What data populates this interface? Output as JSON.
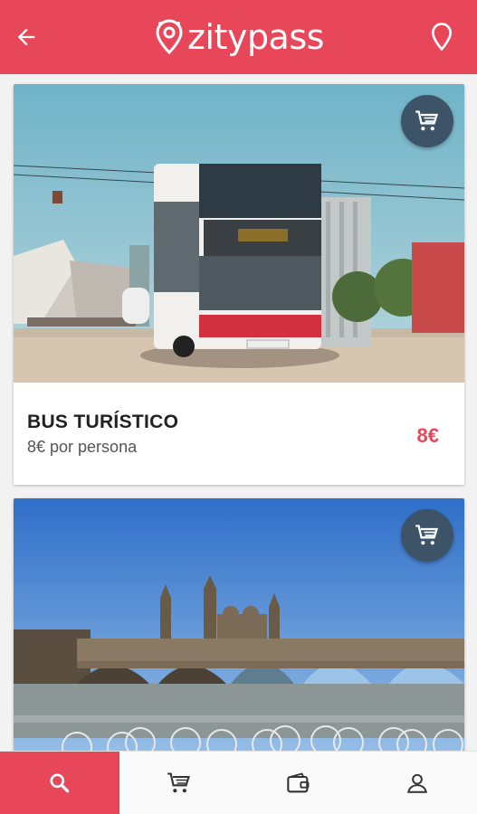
{
  "app": {
    "name": "zitypass",
    "accent": "#e8475a",
    "fab_color": "#3d5468"
  },
  "header": {
    "back_icon": "arrow-left-icon",
    "location_icon": "map-pin-icon"
  },
  "cards": [
    {
      "title": "BUS TURÍSTICO",
      "subtitle": "8€ por persona",
      "price": "8€",
      "image": "double-decker tourist bus",
      "cart_icon": "cart-icon"
    },
    {
      "image": "bridge and basilica with bicycles",
      "cart_icon": "cart-icon"
    }
  ],
  "bottom_nav": [
    {
      "icon": "search-icon",
      "active": true
    },
    {
      "icon": "cart-icon",
      "active": false
    },
    {
      "icon": "wallet-icon",
      "active": false
    },
    {
      "icon": "user-icon",
      "active": false
    }
  ]
}
